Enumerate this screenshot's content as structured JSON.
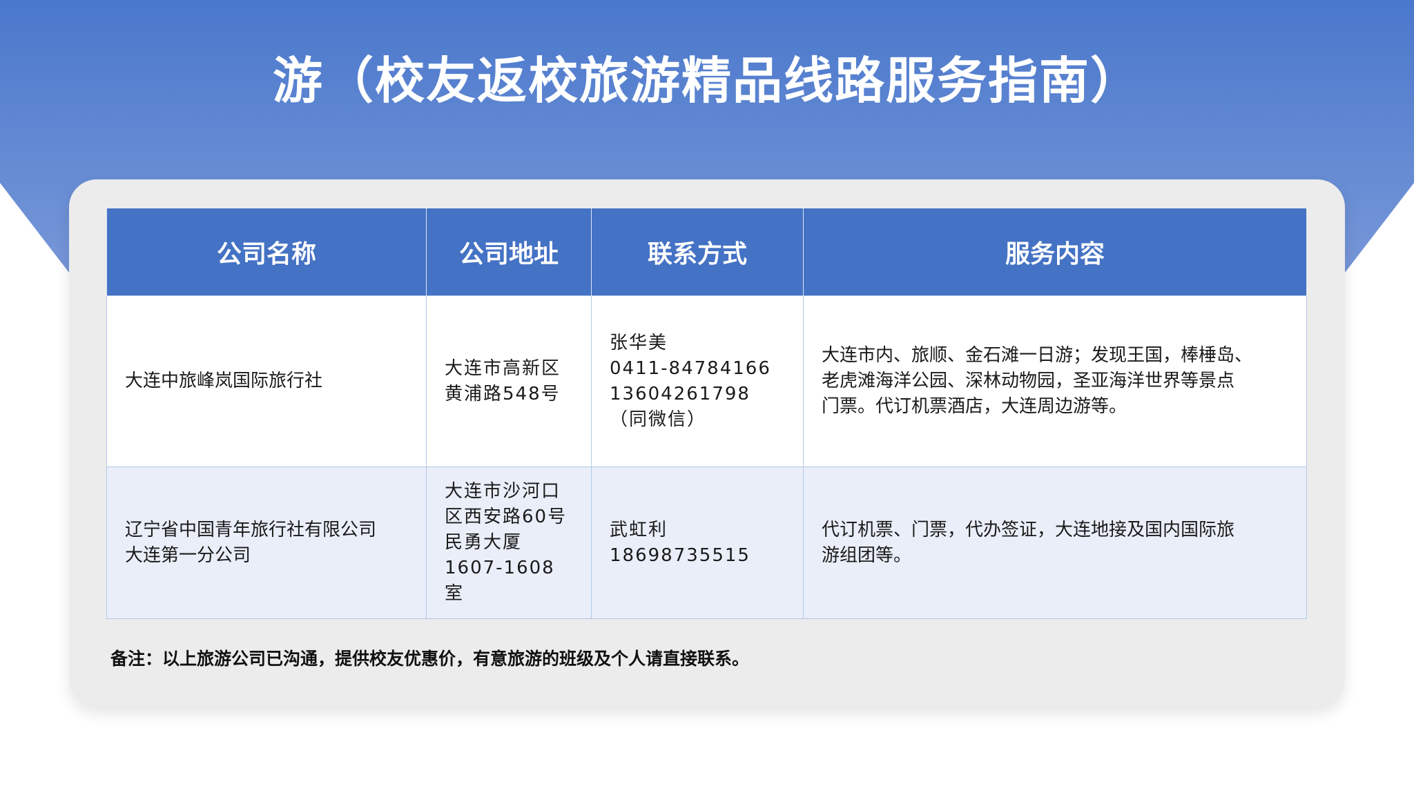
{
  "page": {
    "title": "游（校友返校旅游精品线路服务指南）"
  },
  "colors": {
    "header_blue": "#4472c4",
    "banner_top": "#4a78cc",
    "banner_bottom": "#7797d8",
    "card_bg": "#ececec",
    "row_alt_bg": "#e9eef8",
    "cell_border": "#b4c6e7"
  },
  "table": {
    "headers": [
      "公司名称",
      "公司地址",
      "联系方式",
      "服务内容"
    ],
    "rows": [
      {
        "company": "大连中旅峰岚国际旅行社",
        "address": [
          "大连市高新区",
          "黄浦路548号"
        ],
        "contact": [
          "张华美",
          "0411-84784166",
          "13604261798",
          "（同微信）"
        ],
        "services": [
          "大连市内、旅顺、金石滩一日游；发现王国，棒棰岛、",
          "老虎滩海洋公园、深林动物园，圣亚海洋世界等景点",
          "门票。代订机票酒店，大连周边游等。"
        ]
      },
      {
        "company": [
          "辽宁省中国青年旅行社有限公司",
          "大连第一分公司"
        ],
        "address": [
          "大连市沙河口",
          "区西安路60号",
          "民勇大厦",
          "1607-1608",
          "室"
        ],
        "contact": [
          "武虹利",
          "18698735515"
        ],
        "services": [
          "代订机票、门票，代办签证，大连地接及国内国际旅",
          "游组团等。"
        ]
      }
    ]
  },
  "note": "备注：以上旅游公司已沟通，提供校友优惠价，有意旅游的班级及个人请直接联系。"
}
